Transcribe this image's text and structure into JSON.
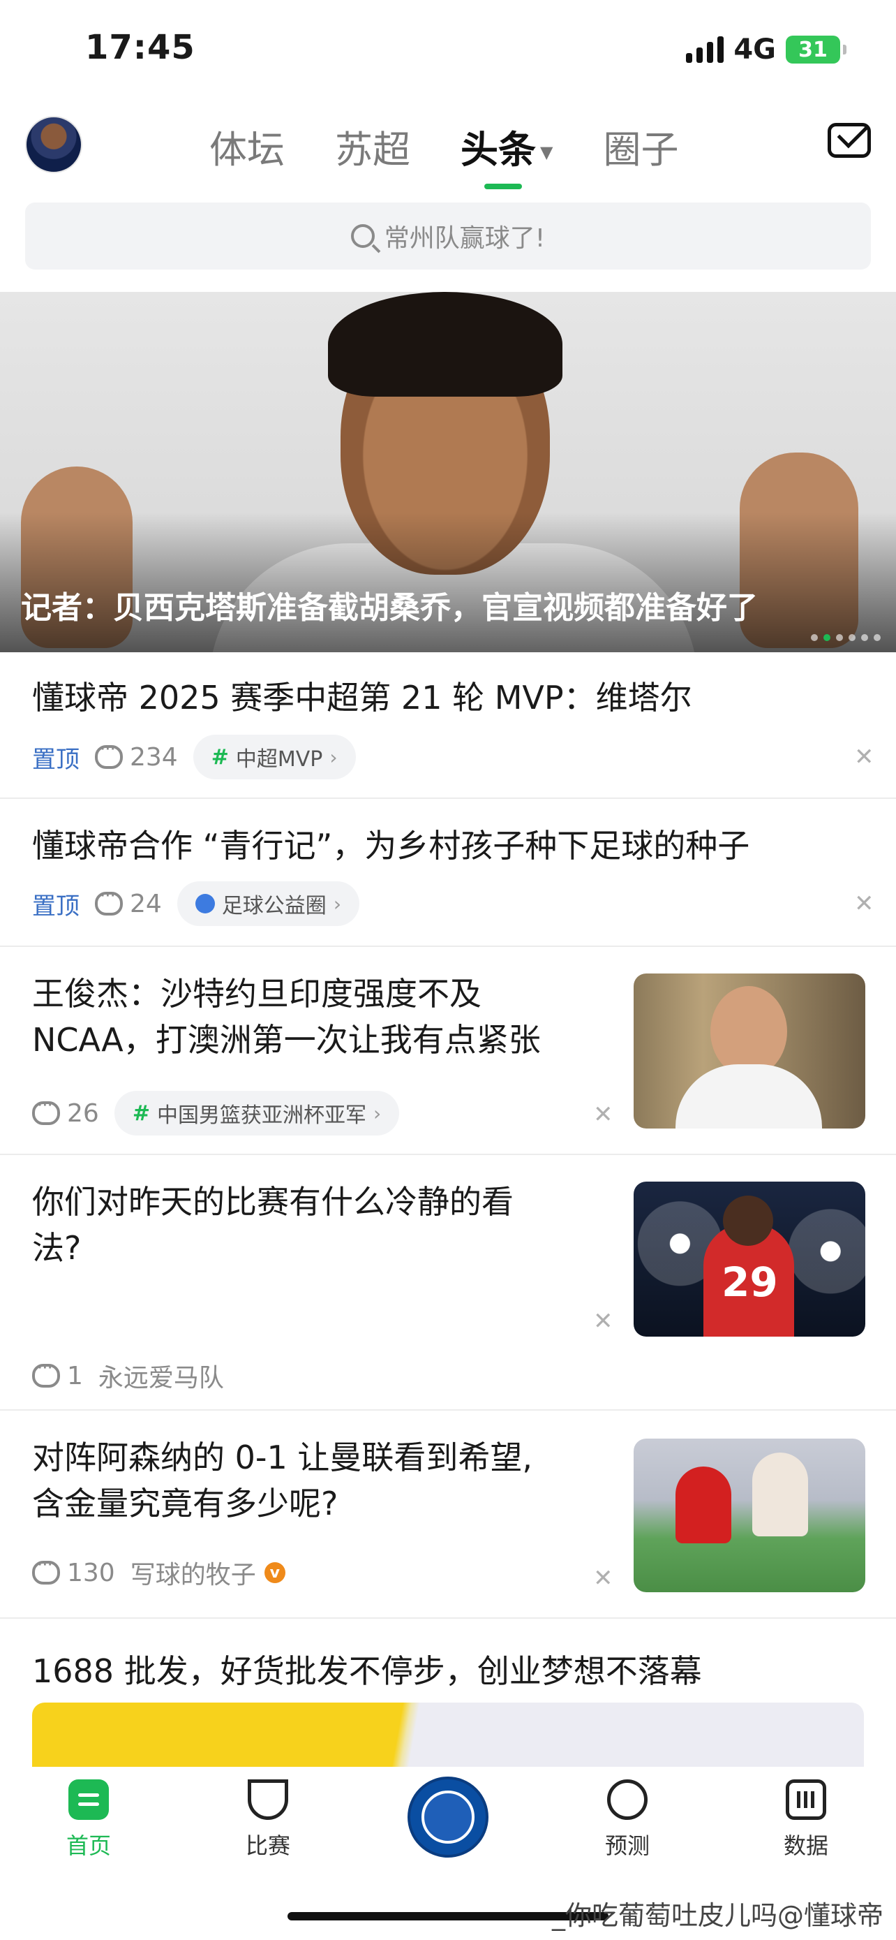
{
  "status": {
    "time": "17:45",
    "network": "4G",
    "battery": "31"
  },
  "header": {
    "tabs": [
      {
        "label": "体坛"
      },
      {
        "label": "苏超"
      },
      {
        "label": "头条",
        "active": true
      },
      {
        "label": "圈子"
      }
    ],
    "search_placeholder": "常州队赢球了!"
  },
  "banner": {
    "caption": "记者：贝西克塔斯准备截胡桑乔，官宣视频都准备好了",
    "dots": 6,
    "active_dot": 1
  },
  "feed": [
    {
      "title": "懂球帝 2025 赛季中超第 21 轮 MVP：维塔尔",
      "pin": "置顶",
      "comments": "234",
      "chip": "中超MVP",
      "chip_icon": "hash"
    },
    {
      "title": "懂球帝合作 “青行记”，为乡村孩子种下足球的种子",
      "pin": "置顶",
      "comments": "24",
      "chip": "足球公益圈",
      "chip_icon": "circle"
    },
    {
      "title_line1": "王俊杰：沙特约旦印度强度不及",
      "title_line2": "NCAA，打澳洲第一次让我有点紧张",
      "comments": "26",
      "chip": "中国男篮获亚洲杯亚军",
      "chip_icon": "hash",
      "thumb": "player-interview"
    },
    {
      "title_line1": "你们对昨天的比赛有什么冷静的看",
      "title_line2": "法?",
      "comments": "1",
      "author": "永远爱马队",
      "thumb": "fofana-29"
    },
    {
      "title_line1": "对阵阿森纳的 0-1 让曼联看到希望,",
      "title_line2": "含金量究竟有多少呢?",
      "comments": "130",
      "author": "写球的牧子",
      "author_badge": "v",
      "thumb": "match-action"
    },
    {
      "title": "1688 批发，好货批发不停步，创业梦想不落幕"
    }
  ],
  "bottom_nav": [
    {
      "label": "首页",
      "icon": "home-icon",
      "active": true
    },
    {
      "label": "比赛",
      "icon": "trophy-icon"
    },
    {
      "label": "",
      "icon": "chelsea-badge"
    },
    {
      "label": "预测",
      "icon": "planet-icon"
    },
    {
      "label": "数据",
      "icon": "chart-icon"
    }
  ],
  "watermark": "_你吃葡萄吐皮儿吗@懂球帝",
  "colors": {
    "accent": "#1db954",
    "pin": "#3a6fc4"
  }
}
